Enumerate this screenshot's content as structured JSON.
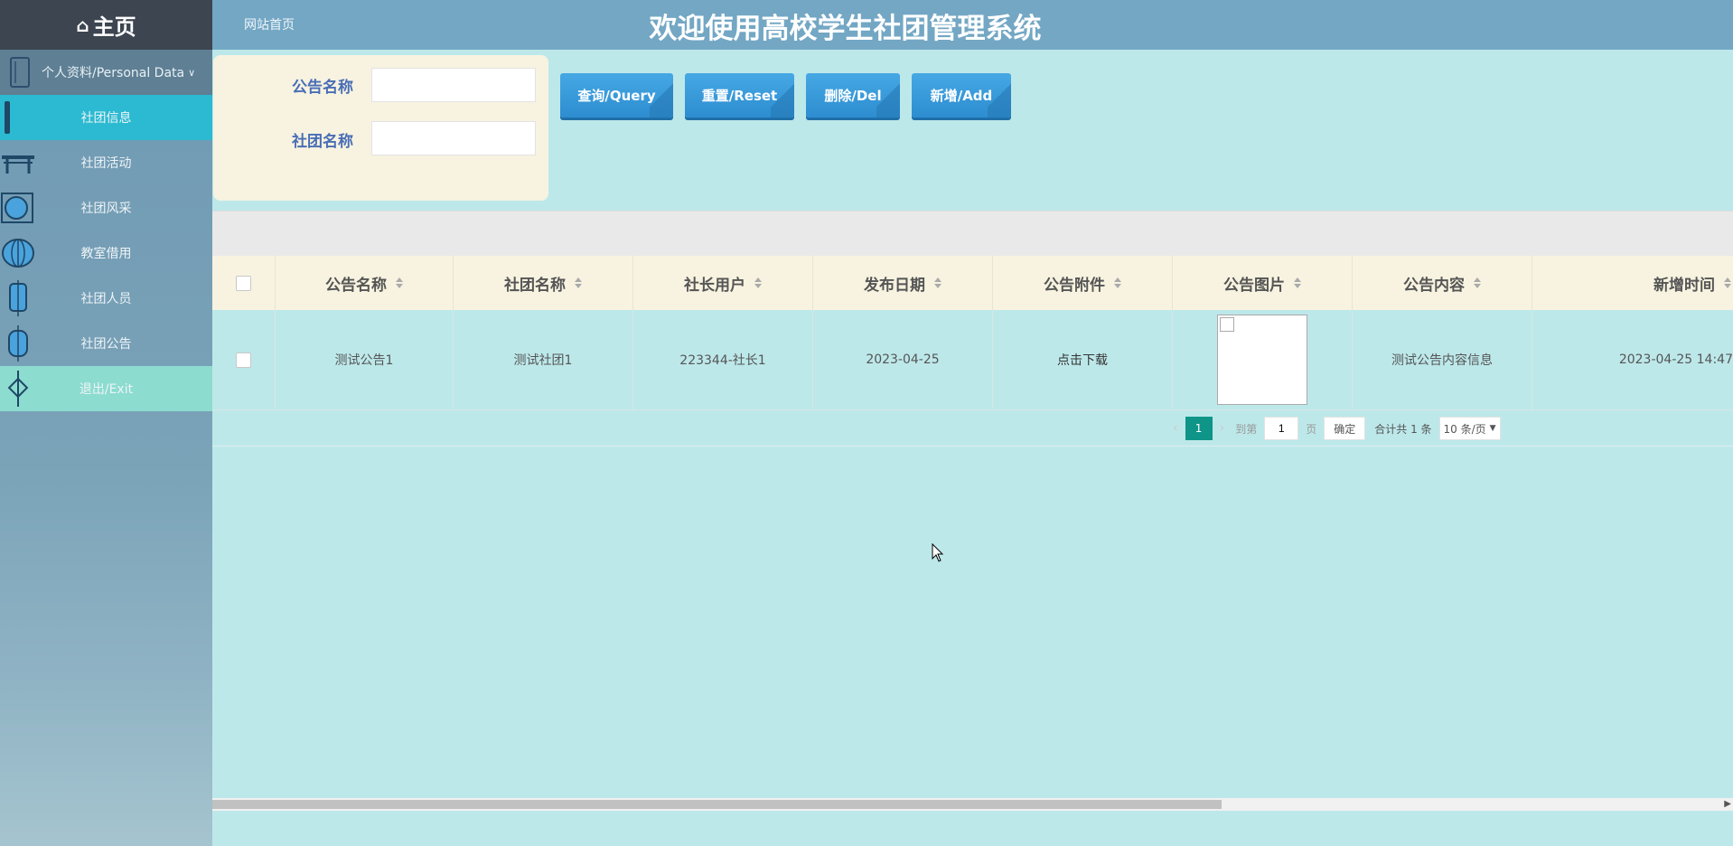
{
  "sidebar": {
    "home_label": "主页",
    "profile_label": "个人资料/Personal Data",
    "items": [
      {
        "label": "社团信息",
        "icon": "scroll-icon"
      },
      {
        "label": "社团活动",
        "icon": "pavilion-icon"
      },
      {
        "label": "社团风采",
        "icon": "fan-icon"
      },
      {
        "label": "教室借用",
        "icon": "lantern-icon"
      },
      {
        "label": "社团人员",
        "icon": "hanging-lantern-icon"
      },
      {
        "label": "社团公告",
        "icon": "lantern-icon"
      },
      {
        "label": "退出/Exit",
        "icon": "chinese-knot-icon"
      }
    ]
  },
  "header": {
    "site_link": "网站首页",
    "title": "欢迎使用高校学生社团管理系统"
  },
  "search": {
    "field1_label": "公告名称",
    "field1_value": "",
    "field2_label": "社团名称",
    "field2_value": ""
  },
  "toolbar": {
    "query_label": "查询/Query",
    "reset_label": "重置/Reset",
    "delete_label": "删除/Del",
    "add_label": "新增/Add"
  },
  "table": {
    "headers": [
      "公告名称",
      "社团名称",
      "社长用户",
      "发布日期",
      "公告附件",
      "公告图片",
      "公告内容",
      "新增时间"
    ],
    "rows": [
      {
        "name": "测试公告1",
        "club": "测试社团1",
        "leader": "223344-社长1",
        "date": "2023-04-25",
        "attachment": "点击下载",
        "content": "测试公告内容信息",
        "created": "2023-04-25 14:47"
      }
    ]
  },
  "pagination": {
    "current_page": "1",
    "goto_label": "到第",
    "goto_value": "1",
    "page_unit": "页",
    "confirm_label": "确定",
    "total_label": "合计共 1 条",
    "page_size": "10 条/页"
  }
}
